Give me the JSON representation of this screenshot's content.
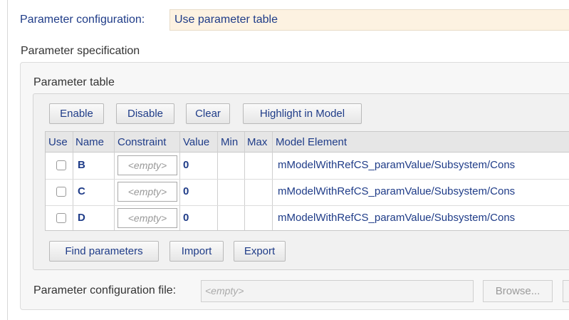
{
  "parameter_configuration": {
    "label": "Parameter configuration:",
    "value": "Use parameter table"
  },
  "parameter_specification": {
    "label": "Parameter specification"
  },
  "parameter_table": {
    "label": "Parameter table",
    "toolbar": {
      "enable": "Enable",
      "disable": "Disable",
      "clear": "Clear",
      "highlight": "Highlight in Model"
    },
    "columns": [
      "Use",
      "Name",
      "Constraint",
      "Value",
      "Min",
      "Max",
      "Model Element"
    ],
    "rows": [
      {
        "use": false,
        "name": "B",
        "constraint": "<empty>",
        "value": "0",
        "min": "",
        "max": "",
        "model_element": "mModelWithRefCS_paramValue/Subsystem/Cons"
      },
      {
        "use": false,
        "name": "C",
        "constraint": "<empty>",
        "value": "0",
        "min": "",
        "max": "",
        "model_element": "mModelWithRefCS_paramValue/Subsystem/Cons"
      },
      {
        "use": false,
        "name": "D",
        "constraint": "<empty>",
        "value": "0",
        "min": "",
        "max": "",
        "model_element": "mModelWithRefCS_paramValue/Subsystem/Cons"
      }
    ],
    "bottom_buttons": {
      "find": "Find parameters",
      "import": "Import",
      "export": "Export"
    }
  },
  "configuration_file": {
    "label": "Parameter configuration file:",
    "placeholder": "<empty>",
    "browse": "Browse..."
  }
}
